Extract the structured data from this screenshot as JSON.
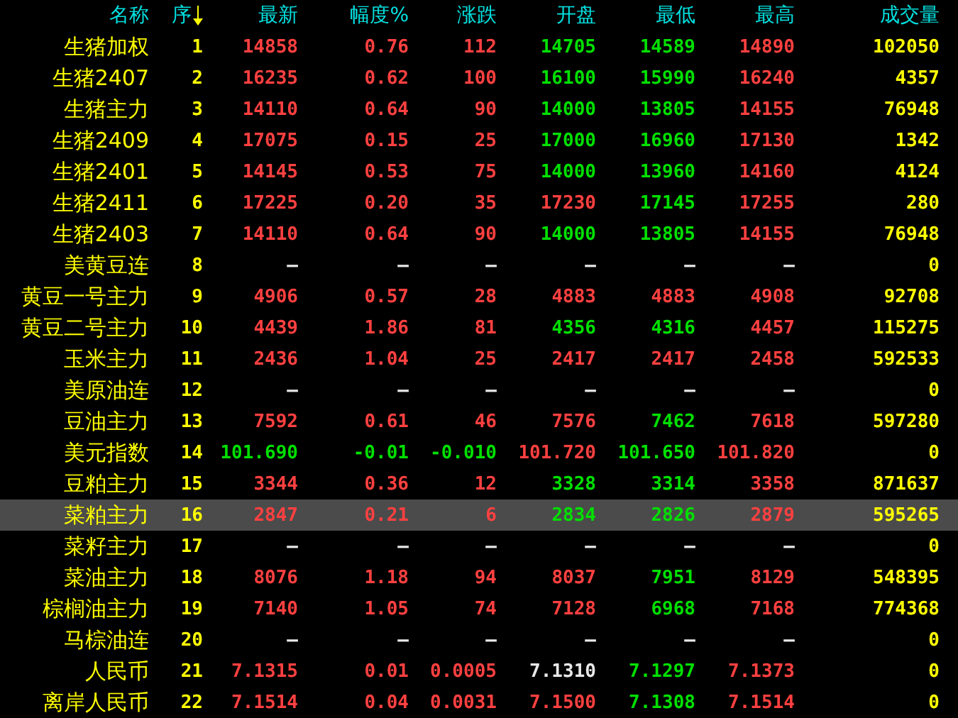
{
  "columns": [
    {
      "label": "名称",
      "sorted": false
    },
    {
      "label": "序",
      "sorted": true
    },
    {
      "label": "最新",
      "sorted": false
    },
    {
      "label": "幅度%",
      "sorted": false
    },
    {
      "label": "涨跌",
      "sorted": false
    },
    {
      "label": "开盘",
      "sorted": false
    },
    {
      "label": "最低",
      "sorted": false
    },
    {
      "label": "最高",
      "sorted": false
    },
    {
      "label": "成交量",
      "sorted": false
    }
  ],
  "rows": [
    {
      "name": "生猪加权",
      "seq": "1",
      "selected": false,
      "volume": "102050",
      "cells": [
        {
          "text": "14858",
          "color": "#ff4040"
        },
        {
          "text": "0.76",
          "color": "#ff4040"
        },
        {
          "text": "112",
          "color": "#ff4040"
        },
        {
          "text": "14705",
          "color": "#00e000"
        },
        {
          "text": "14589",
          "color": "#00e000"
        },
        {
          "text": "14890",
          "color": "#ff4040"
        }
      ]
    },
    {
      "name": "生猪2407",
      "seq": "2",
      "selected": false,
      "volume": "4357",
      "cells": [
        {
          "text": "16235",
          "color": "#ff4040"
        },
        {
          "text": "0.62",
          "color": "#ff4040"
        },
        {
          "text": "100",
          "color": "#ff4040"
        },
        {
          "text": "16100",
          "color": "#00e000"
        },
        {
          "text": "15990",
          "color": "#00e000"
        },
        {
          "text": "16240",
          "color": "#ff4040"
        }
      ]
    },
    {
      "name": "生猪主力",
      "seq": "3",
      "selected": false,
      "volume": "76948",
      "cells": [
        {
          "text": "14110",
          "color": "#ff4040"
        },
        {
          "text": "0.64",
          "color": "#ff4040"
        },
        {
          "text": "90",
          "color": "#ff4040"
        },
        {
          "text": "14000",
          "color": "#00e000"
        },
        {
          "text": "13805",
          "color": "#00e000"
        },
        {
          "text": "14155",
          "color": "#ff4040"
        }
      ]
    },
    {
      "name": "生猪2409",
      "seq": "4",
      "selected": false,
      "volume": "1342",
      "cells": [
        {
          "text": "17075",
          "color": "#ff4040"
        },
        {
          "text": "0.15",
          "color": "#ff4040"
        },
        {
          "text": "25",
          "color": "#ff4040"
        },
        {
          "text": "17000",
          "color": "#00e000"
        },
        {
          "text": "16960",
          "color": "#00e000"
        },
        {
          "text": "17130",
          "color": "#ff4040"
        }
      ]
    },
    {
      "name": "生猪2401",
      "seq": "5",
      "selected": false,
      "volume": "4124",
      "cells": [
        {
          "text": "14145",
          "color": "#ff4040"
        },
        {
          "text": "0.53",
          "color": "#ff4040"
        },
        {
          "text": "75",
          "color": "#ff4040"
        },
        {
          "text": "14000",
          "color": "#00e000"
        },
        {
          "text": "13960",
          "color": "#00e000"
        },
        {
          "text": "14160",
          "color": "#ff4040"
        }
      ]
    },
    {
      "name": "生猪2411",
      "seq": "6",
      "selected": false,
      "volume": "280",
      "cells": [
        {
          "text": "17225",
          "color": "#ff4040"
        },
        {
          "text": "0.20",
          "color": "#ff4040"
        },
        {
          "text": "35",
          "color": "#ff4040"
        },
        {
          "text": "17230",
          "color": "#ff4040"
        },
        {
          "text": "17145",
          "color": "#00e000"
        },
        {
          "text": "17255",
          "color": "#ff4040"
        }
      ]
    },
    {
      "name": "生猪2403",
      "seq": "7",
      "selected": false,
      "volume": "76948",
      "cells": [
        {
          "text": "14110",
          "color": "#ff4040"
        },
        {
          "text": "0.64",
          "color": "#ff4040"
        },
        {
          "text": "90",
          "color": "#ff4040"
        },
        {
          "text": "14000",
          "color": "#00e000"
        },
        {
          "text": "13805",
          "color": "#00e000"
        },
        {
          "text": "14155",
          "color": "#ff4040"
        }
      ]
    },
    {
      "name": "美黄豆连",
      "seq": "8",
      "selected": false,
      "volume": "0",
      "cells": [
        {
          "text": "—",
          "color": "#e8e8e8"
        },
        {
          "text": "—",
          "color": "#e8e8e8"
        },
        {
          "text": "—",
          "color": "#e8e8e8"
        },
        {
          "text": "—",
          "color": "#e8e8e8"
        },
        {
          "text": "—",
          "color": "#e8e8e8"
        },
        {
          "text": "—",
          "color": "#e8e8e8"
        }
      ]
    },
    {
      "name": "黄豆一号主力",
      "seq": "9",
      "selected": false,
      "volume": "92708",
      "cells": [
        {
          "text": "4906",
          "color": "#ff4040"
        },
        {
          "text": "0.57",
          "color": "#ff4040"
        },
        {
          "text": "28",
          "color": "#ff4040"
        },
        {
          "text": "4883",
          "color": "#ff4040"
        },
        {
          "text": "4883",
          "color": "#ff4040"
        },
        {
          "text": "4908",
          "color": "#ff4040"
        }
      ]
    },
    {
      "name": "黄豆二号主力",
      "seq": "10",
      "selected": false,
      "volume": "115275",
      "cells": [
        {
          "text": "4439",
          "color": "#ff4040"
        },
        {
          "text": "1.86",
          "color": "#ff4040"
        },
        {
          "text": "81",
          "color": "#ff4040"
        },
        {
          "text": "4356",
          "color": "#00e000"
        },
        {
          "text": "4316",
          "color": "#00e000"
        },
        {
          "text": "4457",
          "color": "#ff4040"
        }
      ]
    },
    {
      "name": "玉米主力",
      "seq": "11",
      "selected": false,
      "volume": "592533",
      "cells": [
        {
          "text": "2436",
          "color": "#ff4040"
        },
        {
          "text": "1.04",
          "color": "#ff4040"
        },
        {
          "text": "25",
          "color": "#ff4040"
        },
        {
          "text": "2417",
          "color": "#ff4040"
        },
        {
          "text": "2417",
          "color": "#ff4040"
        },
        {
          "text": "2458",
          "color": "#ff4040"
        }
      ]
    },
    {
      "name": "美原油连",
      "seq": "12",
      "selected": false,
      "volume": "0",
      "cells": [
        {
          "text": "—",
          "color": "#e8e8e8"
        },
        {
          "text": "—",
          "color": "#e8e8e8"
        },
        {
          "text": "—",
          "color": "#e8e8e8"
        },
        {
          "text": "—",
          "color": "#e8e8e8"
        },
        {
          "text": "—",
          "color": "#e8e8e8"
        },
        {
          "text": "—",
          "color": "#e8e8e8"
        }
      ]
    },
    {
      "name": "豆油主力",
      "seq": "13",
      "selected": false,
      "volume": "597280",
      "cells": [
        {
          "text": "7592",
          "color": "#ff4040"
        },
        {
          "text": "0.61",
          "color": "#ff4040"
        },
        {
          "text": "46",
          "color": "#ff4040"
        },
        {
          "text": "7576",
          "color": "#ff4040"
        },
        {
          "text": "7462",
          "color": "#00e000"
        },
        {
          "text": "7618",
          "color": "#ff4040"
        }
      ]
    },
    {
      "name": "美元指数",
      "seq": "14",
      "selected": false,
      "volume": "0",
      "cells": [
        {
          "text": "101.690",
          "color": "#00e000"
        },
        {
          "text": "-0.01",
          "color": "#00e000"
        },
        {
          "text": "-0.010",
          "color": "#00e000"
        },
        {
          "text": "101.720",
          "color": "#ff4040"
        },
        {
          "text": "101.650",
          "color": "#00e000"
        },
        {
          "text": "101.820",
          "color": "#ff4040"
        }
      ]
    },
    {
      "name": "豆粕主力",
      "seq": "15",
      "selected": false,
      "volume": "871637",
      "cells": [
        {
          "text": "3344",
          "color": "#ff4040"
        },
        {
          "text": "0.36",
          "color": "#ff4040"
        },
        {
          "text": "12",
          "color": "#ff4040"
        },
        {
          "text": "3328",
          "color": "#00e000"
        },
        {
          "text": "3314",
          "color": "#00e000"
        },
        {
          "text": "3358",
          "color": "#ff4040"
        }
      ]
    },
    {
      "name": "菜粕主力",
      "seq": "16",
      "selected": true,
      "volume": "595265",
      "cells": [
        {
          "text": "2847",
          "color": "#ff4040"
        },
        {
          "text": "0.21",
          "color": "#ff4040"
        },
        {
          "text": "6",
          "color": "#ff4040"
        },
        {
          "text": "2834",
          "color": "#00e000"
        },
        {
          "text": "2826",
          "color": "#00e000"
        },
        {
          "text": "2879",
          "color": "#ff4040"
        }
      ]
    },
    {
      "name": "菜籽主力",
      "seq": "17",
      "selected": false,
      "volume": "0",
      "cells": [
        {
          "text": "—",
          "color": "#e8e8e8"
        },
        {
          "text": "—",
          "color": "#e8e8e8"
        },
        {
          "text": "—",
          "color": "#e8e8e8"
        },
        {
          "text": "—",
          "color": "#e8e8e8"
        },
        {
          "text": "—",
          "color": "#e8e8e8"
        },
        {
          "text": "—",
          "color": "#e8e8e8"
        }
      ]
    },
    {
      "name": "菜油主力",
      "seq": "18",
      "selected": false,
      "volume": "548395",
      "cells": [
        {
          "text": "8076",
          "color": "#ff4040"
        },
        {
          "text": "1.18",
          "color": "#ff4040"
        },
        {
          "text": "94",
          "color": "#ff4040"
        },
        {
          "text": "8037",
          "color": "#ff4040"
        },
        {
          "text": "7951",
          "color": "#00e000"
        },
        {
          "text": "8129",
          "color": "#ff4040"
        }
      ]
    },
    {
      "name": "棕榈油主力",
      "seq": "19",
      "selected": false,
      "volume": "774368",
      "cells": [
        {
          "text": "7140",
          "color": "#ff4040"
        },
        {
          "text": "1.05",
          "color": "#ff4040"
        },
        {
          "text": "74",
          "color": "#ff4040"
        },
        {
          "text": "7128",
          "color": "#ff4040"
        },
        {
          "text": "6968",
          "color": "#00e000"
        },
        {
          "text": "7168",
          "color": "#ff4040"
        }
      ]
    },
    {
      "name": "马棕油连",
      "seq": "20",
      "selected": false,
      "volume": "0",
      "cells": [
        {
          "text": "—",
          "color": "#e8e8e8"
        },
        {
          "text": "—",
          "color": "#e8e8e8"
        },
        {
          "text": "—",
          "color": "#e8e8e8"
        },
        {
          "text": "—",
          "color": "#e8e8e8"
        },
        {
          "text": "—",
          "color": "#e8e8e8"
        },
        {
          "text": "—",
          "color": "#e8e8e8"
        }
      ]
    },
    {
      "name": "人民币",
      "seq": "21",
      "selected": false,
      "volume": "0",
      "cells": [
        {
          "text": "7.1315",
          "color": "#ff4040"
        },
        {
          "text": "0.01",
          "color": "#ff4040"
        },
        {
          "text": "0.0005",
          "color": "#ff4040"
        },
        {
          "text": "7.1310",
          "color": "#e8e8e8"
        },
        {
          "text": "7.1297",
          "color": "#00e000"
        },
        {
          "text": "7.1373",
          "color": "#ff4040"
        }
      ]
    },
    {
      "name": "离岸人民币",
      "seq": "22",
      "selected": false,
      "volume": "0",
      "cells": [
        {
          "text": "7.1514",
          "color": "#ff4040"
        },
        {
          "text": "0.04",
          "color": "#ff4040"
        },
        {
          "text": "0.0031",
          "color": "#ff4040"
        },
        {
          "text": "7.1500",
          "color": "#ff4040"
        },
        {
          "text": "7.1308",
          "color": "#00e000"
        },
        {
          "text": "7.1514",
          "color": "#ff4040"
        }
      ]
    }
  ]
}
